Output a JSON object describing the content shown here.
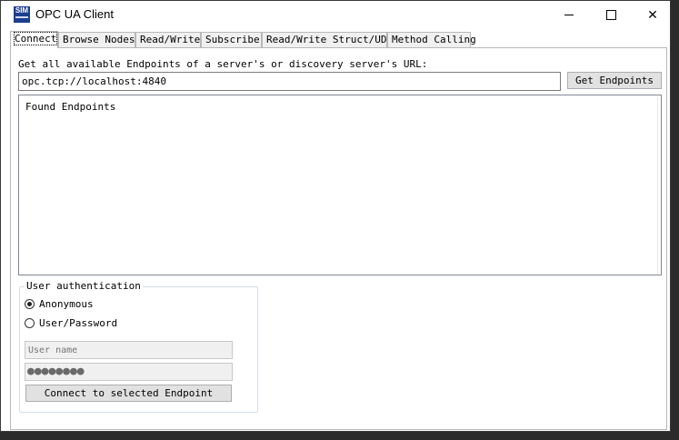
{
  "window": {
    "title": "OPC UA Client",
    "icon_text": "SIM",
    "controls": {
      "minimize": "minimize-icon",
      "maximize": "maximize-icon",
      "close": "✕"
    }
  },
  "tabs": [
    {
      "label": "Connect",
      "active": true
    },
    {
      "label": "Browse Nodes",
      "active": false
    },
    {
      "label": "Read/Write",
      "active": false
    },
    {
      "label": "Subscribe",
      "active": false
    },
    {
      "label": "Read/Write Struct/UDT",
      "active": false
    },
    {
      "label": "Method Calling",
      "active": false
    }
  ],
  "connect": {
    "url_label": "Get all available Endpoints of a server's or discovery server's URL:",
    "url_value": "opc.tcp://localhost:4840",
    "get_endpoints_label": "Get Endpoints",
    "endpoints_header": "Found Endpoints",
    "auth": {
      "legend": "User authentication",
      "anonymous_label": "Anonymous",
      "user_password_label": "User/Password",
      "selected": "Anonymous",
      "username_placeholder": "User name",
      "password_mask": "●●●●●●●●",
      "connect_label": "Connect to selected Endpoint"
    }
  }
}
